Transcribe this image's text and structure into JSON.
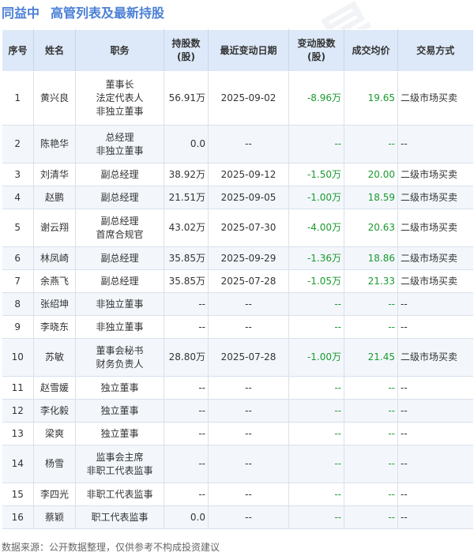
{
  "header": {
    "company": "同益中",
    "title": "高管列表及最新持股"
  },
  "table": {
    "columns": [
      "序号",
      "姓名",
      "职务",
      "持股数\n(股)",
      "最近变动日期",
      "变动股数\n(股)",
      "成交均价",
      "交易方式"
    ],
    "rows": [
      {
        "no": "1",
        "name": "黄兴良",
        "roles": [
          "董事长",
          "法定代表人",
          "非独立董事"
        ],
        "shares": "56.91万",
        "date": "2025-09-02",
        "change": "-8.96万",
        "price": "19.65",
        "method": "二级市场买卖"
      },
      {
        "no": "2",
        "name": "陈艳华",
        "roles": [
          "总经理",
          "非独立董事"
        ],
        "shares": "0.0",
        "date": "--",
        "change": "--",
        "price": "--",
        "method": "--"
      },
      {
        "no": "3",
        "name": "刘清华",
        "roles": [
          "副总经理"
        ],
        "shares": "38.92万",
        "date": "2025-09-12",
        "change": "-1.50万",
        "price": "20.00",
        "method": "二级市场买卖"
      },
      {
        "no": "4",
        "name": "赵鹏",
        "roles": [
          "副总经理"
        ],
        "shares": "21.51万",
        "date": "2025-09-05",
        "change": "-1.00万",
        "price": "18.59",
        "method": "二级市场买卖"
      },
      {
        "no": "5",
        "name": "谢云翔",
        "roles": [
          "副总经理",
          "首席合规官"
        ],
        "shares": "43.02万",
        "date": "2025-07-30",
        "change": "-4.00万",
        "price": "20.63",
        "method": "二级市场买卖"
      },
      {
        "no": "6",
        "name": "林凤崎",
        "roles": [
          "副总经理"
        ],
        "shares": "35.85万",
        "date": "2025-09-29",
        "change": "-1.36万",
        "price": "18.86",
        "method": "二级市场买卖"
      },
      {
        "no": "7",
        "name": "余燕飞",
        "roles": [
          "副总经理"
        ],
        "shares": "35.85万",
        "date": "2025-07-28",
        "change": "-1.05万",
        "price": "21.33",
        "method": "二级市场买卖"
      },
      {
        "no": "8",
        "name": "张绍坤",
        "roles": [
          "非独立董事"
        ],
        "shares": "--",
        "date": "--",
        "change": "--",
        "price": "--",
        "method": "--"
      },
      {
        "no": "9",
        "name": "李晓东",
        "roles": [
          "非独立董事"
        ],
        "shares": "--",
        "date": "--",
        "change": "--",
        "price": "--",
        "method": "--"
      },
      {
        "no": "10",
        "name": "苏敏",
        "roles": [
          "董事会秘书",
          "财务负责人"
        ],
        "shares": "28.80万",
        "date": "2025-07-28",
        "change": "-1.00万",
        "price": "21.45",
        "method": "二级市场买卖"
      },
      {
        "no": "11",
        "name": "赵雪媛",
        "roles": [
          "独立董事"
        ],
        "shares": "--",
        "date": "--",
        "change": "--",
        "price": "--",
        "method": "--"
      },
      {
        "no": "12",
        "name": "李化毅",
        "roles": [
          "独立董事"
        ],
        "shares": "--",
        "date": "--",
        "change": "--",
        "price": "--",
        "method": "--"
      },
      {
        "no": "13",
        "name": "梁爽",
        "roles": [
          "独立董事"
        ],
        "shares": "--",
        "date": "--",
        "change": "--",
        "price": "--",
        "method": "--"
      },
      {
        "no": "14",
        "name": "杨雪",
        "roles": [
          "监事会主席",
          "非职工代表监事"
        ],
        "shares": "--",
        "date": "--",
        "change": "--",
        "price": "--",
        "method": "--"
      },
      {
        "no": "15",
        "name": "李四光",
        "roles": [
          "非职工代表监事"
        ],
        "shares": "--",
        "date": "--",
        "change": "--",
        "price": "--",
        "method": "--"
      },
      {
        "no": "16",
        "name": "蔡颖",
        "roles": [
          "职工代表监事"
        ],
        "shares": "0.0",
        "date": "--",
        "change": "--",
        "price": "--",
        "method": "--"
      }
    ]
  },
  "footer": {
    "source": "数据来源：公开数据整理，仅供参考不构成投资建议"
  },
  "colors": {
    "title": "#4a7fd6",
    "header_bg": "#dde9f8",
    "stripe_bg": "#f3f7fc",
    "negative": "#1a9a2e"
  }
}
